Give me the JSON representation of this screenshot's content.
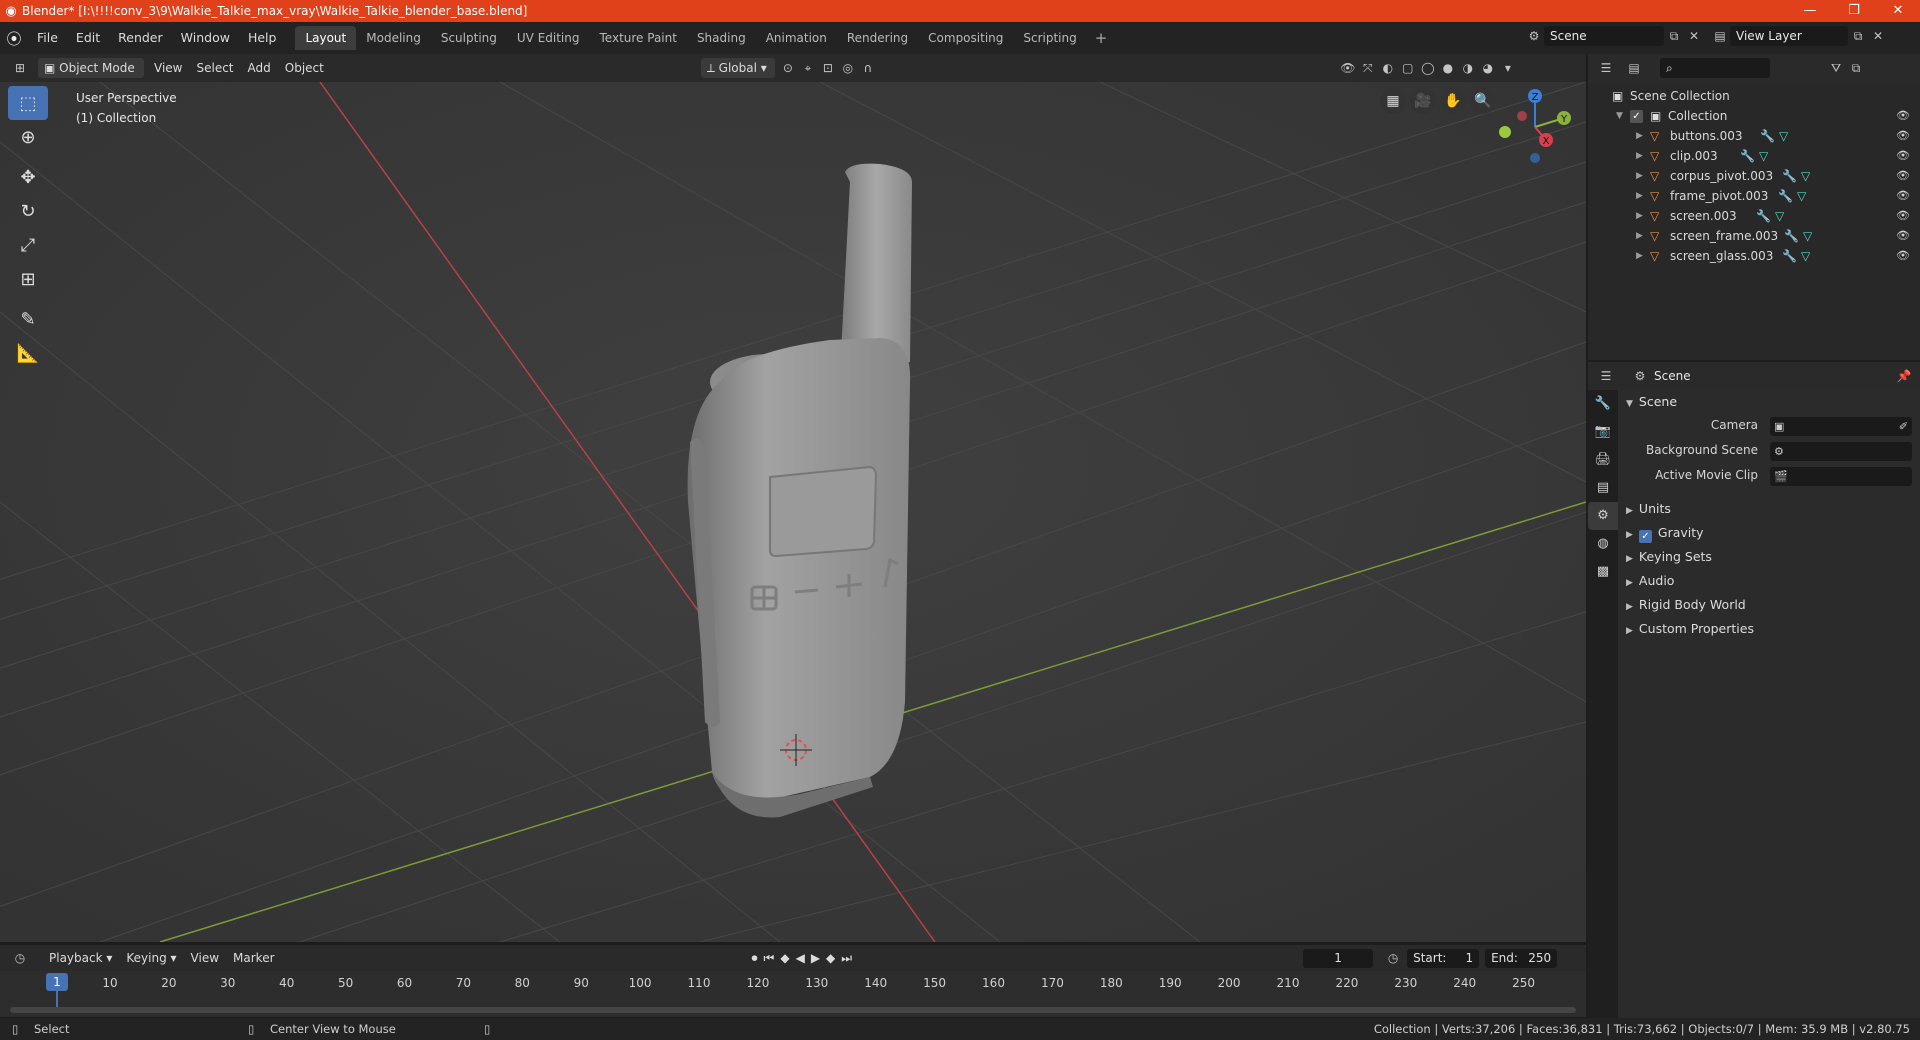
{
  "window": {
    "title": "Blender* [I:\\!!!!conv_3\\9\\Walkie_Talkie_max_vray\\Walkie_Talkie_blender_base.blend]",
    "controls": [
      "—",
      "❐",
      "✕"
    ]
  },
  "menu": [
    "File",
    "Edit",
    "Render",
    "Window",
    "Help"
  ],
  "workspaces": [
    "Layout",
    "Modeling",
    "Sculpting",
    "UV Editing",
    "Texture Paint",
    "Shading",
    "Animation",
    "Rendering",
    "Compositing",
    "Scripting"
  ],
  "active_workspace": "Layout",
  "scene_selector": "Scene",
  "view_layer_selector": "View Layer",
  "viewport": {
    "mode": "Object Mode",
    "menus": [
      "View",
      "Select",
      "Add",
      "Object"
    ],
    "orientation": "Global",
    "info_line1": "User Perspective",
    "info_line2": "(1) Collection",
    "gizmo_axes": {
      "x": "X",
      "y": "Y",
      "z": "Z"
    },
    "colors": {
      "x_axis": "#c0404a",
      "y_axis": "#8aa83c",
      "background": "#3a3a3a"
    }
  },
  "tools": [
    "select-box",
    "cursor",
    "move",
    "rotate",
    "scale",
    "transform",
    "annotate",
    "measure"
  ],
  "outliner": {
    "root": "Scene Collection",
    "collection": "Collection",
    "objects": [
      "buttons.003",
      "clip.003",
      "corpus_pivot.003",
      "frame_pivot.003",
      "screen.003",
      "screen_frame.003",
      "screen_glass.003"
    ]
  },
  "properties": {
    "header_title": "Scene",
    "panel_title": "Scene",
    "camera_label": "Camera",
    "bg_scene_label": "Background Scene",
    "movie_clip_label": "Active Movie Clip",
    "sections": [
      "Units",
      "Gravity",
      "Keying Sets",
      "Audio",
      "Rigid Body World",
      "Custom Properties"
    ],
    "gravity_checked": true
  },
  "timeline": {
    "menus": [
      "Playback",
      "Keying",
      "View",
      "Marker"
    ],
    "current_frame": "1",
    "start_label": "Start:",
    "start": "1",
    "end_label": "End:",
    "end": "250",
    "ticks": [
      "10",
      "20",
      "30",
      "40",
      "50",
      "60",
      "70",
      "80",
      "90",
      "100",
      "110",
      "120",
      "130",
      "140",
      "150",
      "160",
      "170",
      "180",
      "190",
      "200",
      "210",
      "220",
      "230",
      "240",
      "250"
    ],
    "cursor_label": "1"
  },
  "statusbar": {
    "left_action": "Select",
    "mid_action": "Center View to Mouse",
    "stats": "Collection | Verts:37,206 | Faces:36,831 | Tris:73,662 | Objects:0/7 | Mem: 35.9 MB | v2.80.75"
  }
}
